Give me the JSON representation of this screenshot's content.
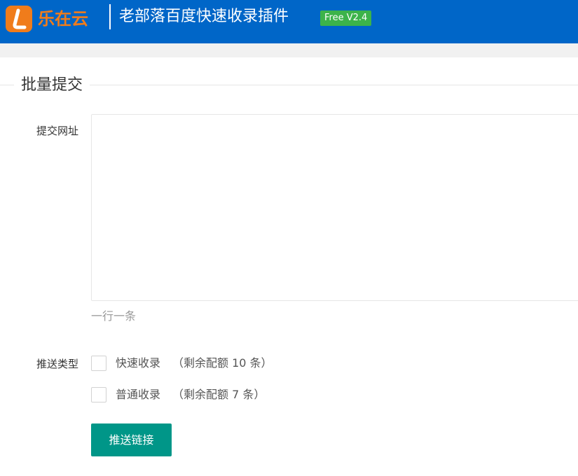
{
  "header": {
    "logo_text": "乐在云",
    "title": "老部落百度快速收录插件",
    "version": "Free V2.4"
  },
  "section": {
    "title": "批量提交"
  },
  "form": {
    "url_label": "提交网址",
    "url_value": "",
    "url_hint": "一行一条",
    "push_type_label": "推送类型",
    "options": [
      {
        "label": "快速收录",
        "quota": "（剩余配额 10 条）",
        "checked": false
      },
      {
        "label": "普通收录",
        "quota": "（剩余配额 7 条）",
        "checked": false
      }
    ],
    "submit_label": "推送链接"
  },
  "colors": {
    "header_bg": "#0066c8",
    "logo_orange": "#f07c1b",
    "badge_green": "#3cb34a",
    "button_teal": "#009688"
  },
  "icons": {
    "logo": "letter-l-logo-icon"
  }
}
